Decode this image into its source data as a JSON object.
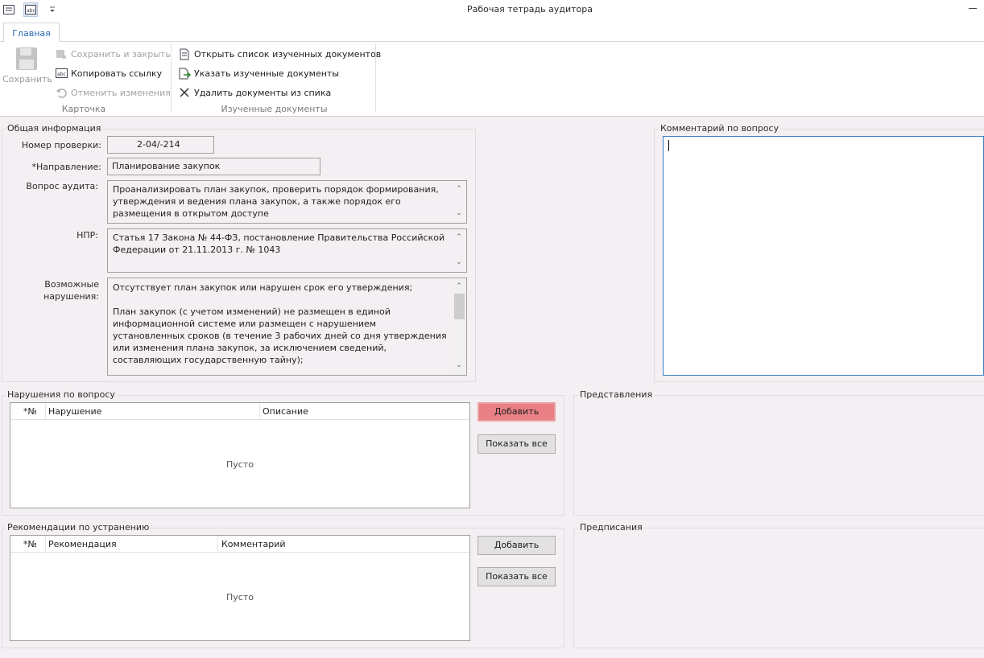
{
  "window": {
    "title": "Рабочая тетрадь аудитора"
  },
  "tabs": [
    {
      "label": "Главная"
    }
  ],
  "ribbon": {
    "save": "Сохранить",
    "save_close": "Сохранить и закрыть",
    "copy_link": "Копировать ссылку",
    "undo": "Отменить изменения",
    "group_card": "Карточка",
    "open_list": "Открыть список изученных документов",
    "mark_docs": "Указать изученные документы",
    "remove_docs": "Удалить документы из спика",
    "group_docs": "Изученные документы"
  },
  "general": {
    "title": "Общая информация",
    "check_number_label": "Номер проверки:",
    "check_number": "2-04/-214",
    "direction_label": "*Направление:",
    "direction": "Планирование закупок",
    "question_label": "Вопрос аудита:",
    "question": "Проанализировать план закупок, проверить порядок формирования, утверждения и ведения плана закупок, а также порядок его размещения в открытом доступе",
    "npr_label": "НПР:",
    "npr": "Статья 17 Закона № 44-ФЗ, постановление Правительства Российской Федерации от 21.11.2013 г. № 1043",
    "violations_label_1": "Возможные",
    "violations_label_2": "нарушения:",
    "violations_p1": "Отсутствует план закупок или нарушен срок его утверждения;",
    "violations_p2": "План закупок (с учетом изменений) не размещен в единой информационной системе или размещен с нарушением установленных сроков (в течение 3 рабочих дней со дня утверждения или изменения плана закупок, за исключением сведений, составляющих государственную тайну);"
  },
  "comment": {
    "title": "Комментарий по вопросу",
    "value": ""
  },
  "violations": {
    "title": "Нарушения по вопросу",
    "columns": [
      "*№",
      "Нарушение",
      "Описание"
    ],
    "empty": "Пусто",
    "add": "Добавить",
    "show_all": "Показать все"
  },
  "representations": {
    "title": "Представления"
  },
  "recommendations": {
    "title": "Рекомендации по устранению",
    "columns": [
      "*№",
      "Рекомендация",
      "Комментарий"
    ],
    "empty": "Пусто",
    "add": "Добавить",
    "show_all": "Показать все"
  },
  "prescriptions": {
    "title": "Предписания"
  },
  "colors": {
    "accent": "#2a69b0",
    "highlight": "#e98085",
    "background": "#f4eff2"
  }
}
